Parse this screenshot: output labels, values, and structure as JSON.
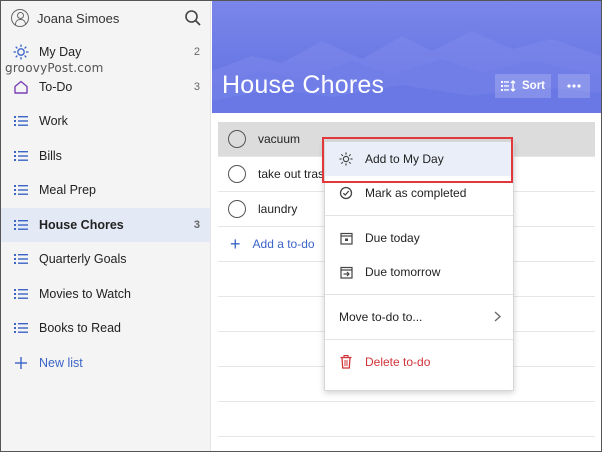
{
  "user": {
    "name": "Joana Simoes"
  },
  "watermark": "groovyPost.com",
  "sidebar": {
    "items": [
      {
        "label": "My Day",
        "count": "2",
        "icon": "sun-icon"
      },
      {
        "label": "To-Do",
        "count": "3",
        "icon": "home-icon"
      },
      {
        "label": "Work",
        "count": "",
        "icon": "list-icon"
      },
      {
        "label": "Bills",
        "count": "",
        "icon": "list-icon"
      },
      {
        "label": "Meal Prep",
        "count": "",
        "icon": "list-icon"
      },
      {
        "label": "House Chores",
        "count": "3",
        "icon": "list-icon"
      },
      {
        "label": "Quarterly Goals",
        "count": "",
        "icon": "list-icon"
      },
      {
        "label": "Movies to Watch",
        "count": "",
        "icon": "list-icon"
      },
      {
        "label": "Books to Read",
        "count": "",
        "icon": "list-icon"
      }
    ],
    "new_list": "New list"
  },
  "header": {
    "title": "House Chores",
    "sort_label": "Sort"
  },
  "tasks": [
    {
      "title": "vacuum"
    },
    {
      "title": "take out trash"
    },
    {
      "title": "laundry"
    }
  ],
  "add_todo": "Add a to-do",
  "context_menu": {
    "add_to_my_day": "Add to My Day",
    "mark_completed": "Mark as completed",
    "due_today": "Due today",
    "due_tomorrow": "Due tomorrow",
    "move_to": "Move to-do to...",
    "delete": "Delete to-do"
  },
  "colors": {
    "accent": "#3b64c7",
    "header": "#6a78e6",
    "danger": "#d13438",
    "highlight_box": "#e0383b"
  }
}
